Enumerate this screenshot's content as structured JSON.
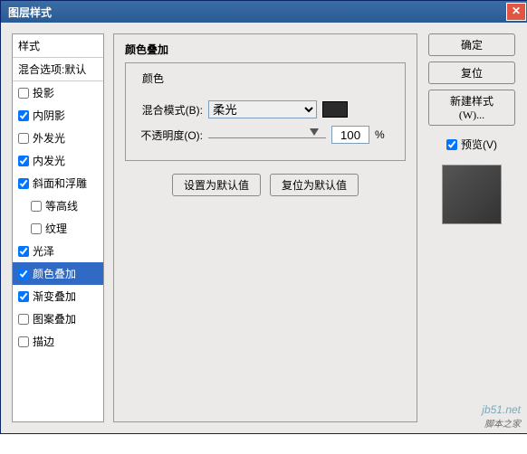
{
  "title": "图层样式",
  "styles": {
    "header": "样式",
    "blending": "混合选项:默认",
    "items": [
      {
        "label": "投影",
        "checked": false
      },
      {
        "label": "内阴影",
        "checked": true
      },
      {
        "label": "外发光",
        "checked": false
      },
      {
        "label": "内发光",
        "checked": true
      },
      {
        "label": "斜面和浮雕",
        "checked": true
      },
      {
        "label": "等高线",
        "checked": false,
        "sub": true
      },
      {
        "label": "纹理",
        "checked": false,
        "sub": true
      },
      {
        "label": "光泽",
        "checked": true
      },
      {
        "label": "颜色叠加",
        "checked": true,
        "selected": true
      },
      {
        "label": "渐变叠加",
        "checked": true
      },
      {
        "label": "图案叠加",
        "checked": false
      },
      {
        "label": "描边",
        "checked": false
      }
    ]
  },
  "main": {
    "title": "颜色叠加",
    "group": "颜色",
    "blend_label": "混合模式(B):",
    "blend_value": "柔光",
    "opacity_label": "不透明度(O):",
    "opacity_value": "100",
    "percent": "%",
    "btn_default": "设置为默认值",
    "btn_reset": "复位为默认值"
  },
  "right": {
    "ok": "确定",
    "cancel": "复位",
    "new_style": "新建样式(W)...",
    "preview": "预览(V)"
  },
  "watermark": {
    "site": "jb51.net",
    "name": "脚本之家"
  }
}
